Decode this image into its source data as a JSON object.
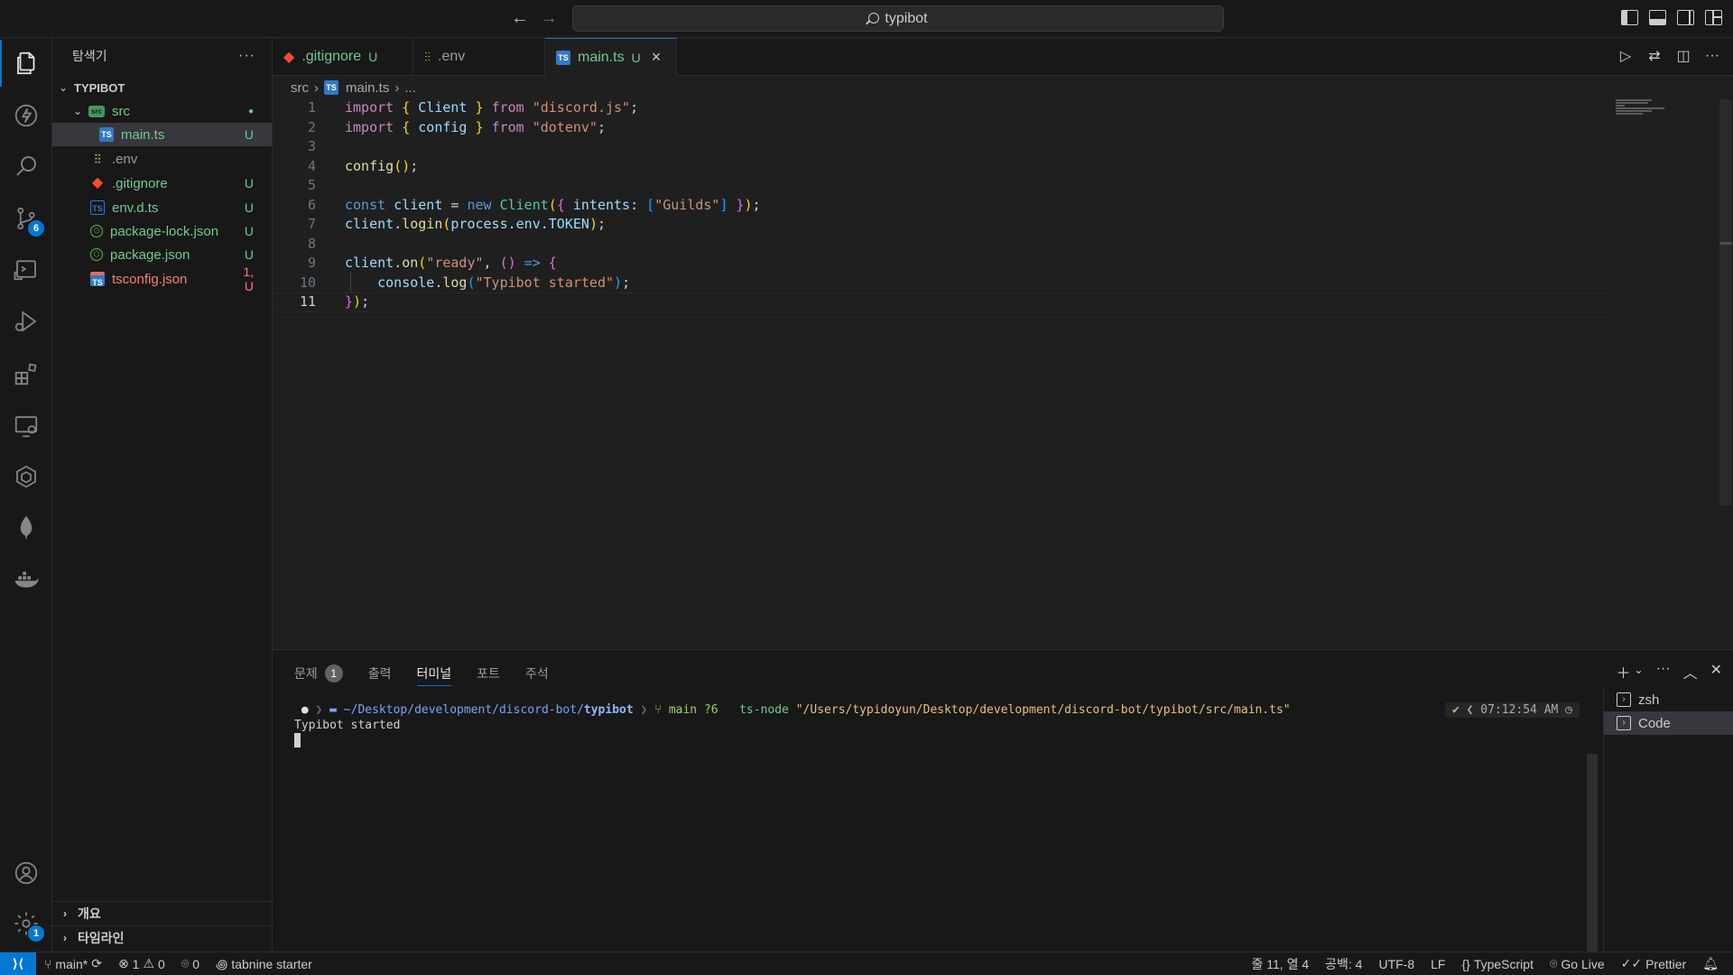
{
  "titlebar": {
    "search_text": "typibot",
    "back_icon": "arrow-left-icon",
    "forward_icon": "arrow-right-icon"
  },
  "activity_bar": {
    "items": [
      {
        "name": "explorer-icon",
        "active": true
      },
      {
        "name": "lightning-icon"
      },
      {
        "name": "search-icon"
      },
      {
        "name": "source-control-icon",
        "badge": "6"
      },
      {
        "name": "remote-debug-icon"
      },
      {
        "name": "run-debug-icon"
      },
      {
        "name": "extensions-icon"
      },
      {
        "name": "remote-explorer-icon"
      },
      {
        "name": "packages-icon"
      },
      {
        "name": "mongodb-leaf-icon"
      },
      {
        "name": "docker-icon"
      }
    ],
    "accounts_icon": "account-icon",
    "settings_badge": "1"
  },
  "sidebar": {
    "title": "탐색기",
    "project": "TYPIBOT",
    "tree": [
      {
        "label": "src",
        "kind": "folder",
        "status": "●",
        "status_color": "green",
        "depth": 1
      },
      {
        "label": "main.ts",
        "kind": "ts",
        "status": "U",
        "status_color": "green",
        "depth": 2,
        "selected": true
      },
      {
        "label": ".env",
        "kind": "env",
        "status": "",
        "status_color": "",
        "depth": 1
      },
      {
        "label": ".gitignore",
        "kind": "git",
        "status": "U",
        "status_color": "green",
        "depth": 1
      },
      {
        "label": "env.d.ts",
        "kind": "ts",
        "status": "U",
        "status_color": "green",
        "depth": 1
      },
      {
        "label": "package-lock.json",
        "kind": "node",
        "status": "U",
        "status_color": "green",
        "depth": 1
      },
      {
        "label": "package.json",
        "kind": "node",
        "status": "U",
        "status_color": "green",
        "depth": 1
      },
      {
        "label": "tsconfig.json",
        "kind": "tsconfig",
        "status": "1, U",
        "status_color": "red",
        "depth": 1
      }
    ],
    "sections": [
      "개요",
      "타임라인"
    ]
  },
  "tabs": [
    {
      "label": ".gitignore",
      "status": "U",
      "icon": "git-icon"
    },
    {
      "label": ".env",
      "status": "",
      "icon": "env-icon"
    },
    {
      "label": "main.ts",
      "status": "U",
      "icon": "typescript-icon",
      "active": true
    }
  ],
  "breadcrumb": {
    "folder": "src",
    "file": "main.ts",
    "more": "..."
  },
  "editor": {
    "current_line": 11
  },
  "panel": {
    "tabs": [
      {
        "label": "문제",
        "badge": "1"
      },
      {
        "label": "출력"
      },
      {
        "label": "터미널",
        "active": true
      },
      {
        "label": "포트"
      },
      {
        "label": "주석"
      }
    ],
    "terminal": {
      "path_prefix": "~/Desktop/development/discord-bot/",
      "path_dir": "typibot",
      "branch": "main ?6",
      "command": "ts-node",
      "argument": "\"/Users/typidoyun/Desktop/development/discord-bot/typibot/src/main.ts\"",
      "time": "07:12:54 AM",
      "output": "Typibot started"
    },
    "terminal_list": [
      {
        "label": "zsh"
      },
      {
        "label": "Code",
        "active": true
      }
    ]
  },
  "statusbar": {
    "branch": "main*",
    "errors": "1",
    "warnings": "0",
    "ports": "0",
    "tabnine": "tabnine starter",
    "position": "줄 11, 열 4",
    "spaces": "공백: 4",
    "encoding": "UTF-8",
    "eol": "LF",
    "language": "TypeScript",
    "golive": "Go Live",
    "prettier": "Prettier"
  }
}
